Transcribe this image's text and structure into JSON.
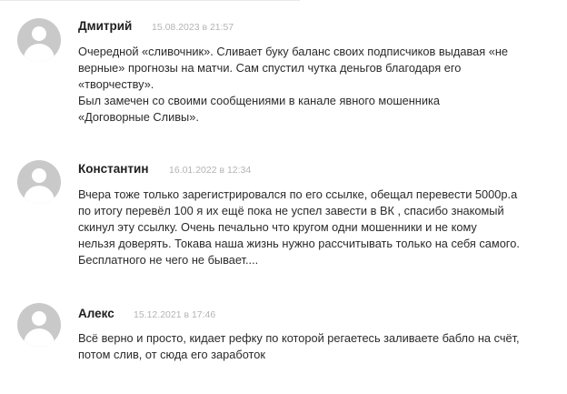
{
  "comments": [
    {
      "author": "Дмитрий",
      "date": "15.08.2023 в 21:57",
      "lines": [
        "Очередной «сливочник». Сливает буку баланс своих подписчиков выдавая «не",
        "верные» прогнозы на матчи. Сам спустил чутка деньгов благодаря его",
        "«творчеству».",
        "Был замечен со своими сообщениями в канале явного мошенника",
        "«Договорные Сливы»."
      ]
    },
    {
      "author": "Константин",
      "date": "16.01.2022 в 12:34",
      "lines": [
        "Вчера тоже только зарегистрировался по его ссылке, обещал перевести 5000р.а",
        "по итогу перевёл 100 я их ещё пока не успел завести в ВК , спасибо знакомый",
        "скинул эту ссылку. Очень печально что кругом одни мошенники и не кому",
        "нельзя доверять. Токава наша жизнь нужно рассчитывать только на себя самого.",
        "Бесплатного не чего не бывает...."
      ]
    },
    {
      "author": "Алекс",
      "date": "15.12.2021 в 17:46",
      "lines": [
        "Всё верно и просто, кидает рефку по которой регаетесь заливаете бабло на счёт,",
        "потом слив, от сюда его заработок"
      ]
    }
  ]
}
